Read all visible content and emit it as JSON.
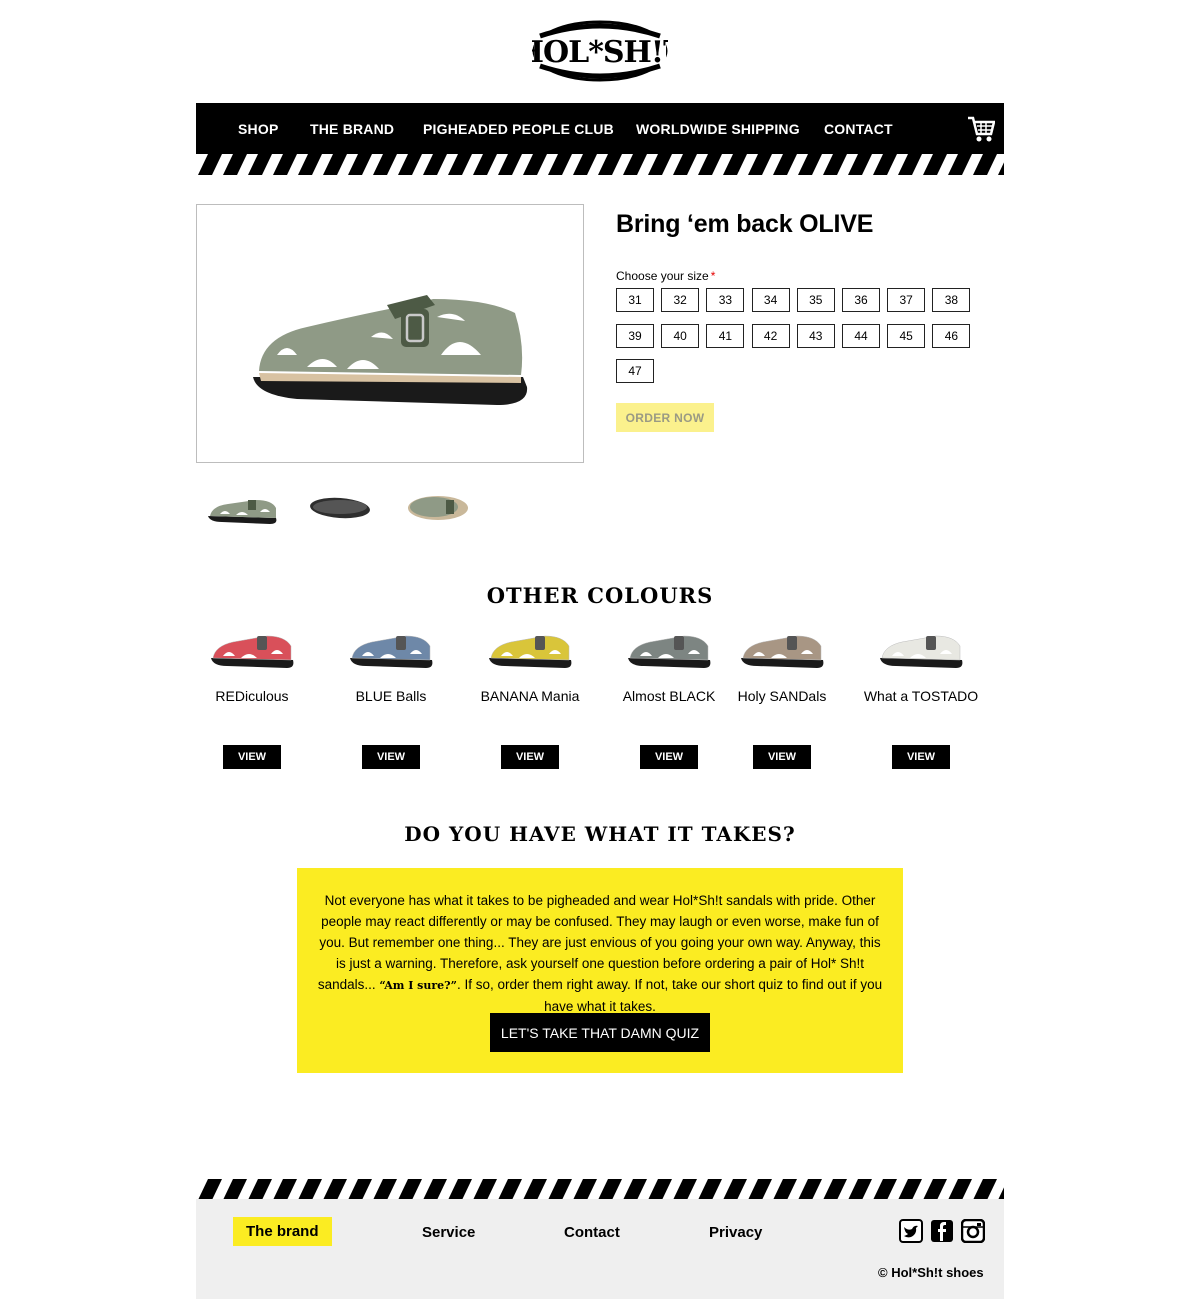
{
  "brand": {
    "logo_text": "HOL*SH!T"
  },
  "nav": {
    "items": [
      "SHOP",
      "THE BRAND",
      "PIGHEADED PEOPLE CLUB",
      "WORLDWIDE SHIPPING",
      "CONTACT"
    ],
    "cart_icon": "shopping-cart-icon"
  },
  "product": {
    "title": "Bring ‘em back OLIVE",
    "size_label": "Choose your size",
    "required_mark": "*",
    "sizes": [
      "31",
      "32",
      "33",
      "34",
      "35",
      "36",
      "37",
      "38",
      "39",
      "40",
      "41",
      "42",
      "43",
      "44",
      "45",
      "46",
      "47"
    ],
    "order_label": "ORDER NOW"
  },
  "other_colours": {
    "heading": "OTHER COLOURS",
    "items": [
      {
        "name": "REDiculous",
        "view": "VIEW",
        "color": "#d9505a"
      },
      {
        "name": "BLUE Balls",
        "view": "VIEW",
        "color": "#6e88a8"
      },
      {
        "name": "BANANA Mania",
        "view": "VIEW",
        "color": "#d9c53a"
      },
      {
        "name": "Almost BLACK",
        "view": "VIEW",
        "color": "#7d8582"
      },
      {
        "name": "Holy SANDals",
        "view": "VIEW",
        "color": "#a89684"
      },
      {
        "name": "What a TOSTADO",
        "view": "VIEW",
        "color": "#e8e8e2"
      }
    ]
  },
  "takes": {
    "heading": "DO YOU HAVE WHAT IT TAKES?",
    "text_before": "Not everyone has what it takes to be pigheaded and wear Hol*Sh!t sandals with pride. Other people may react differently or may be confused. They may laugh or even worse, make fun of you. But remember one thing... They are just envious of you going your own way. Anyway, this is just a warning. Therefore, ask yourself one question before ordering a pair of Hol* Sh!t sandals... ",
    "text_quote": "“Am I sure?”",
    "text_after": ". If so, order them right away. If not, take our short quiz to find out if you have what it takes.",
    "quiz_label": "LET'S TAKE THAT DAMN QUIZ"
  },
  "footer": {
    "links": [
      "The brand",
      "Service",
      "Contact",
      "Privacy"
    ],
    "social_icons": [
      "twitter-icon",
      "facebook-icon",
      "instagram-icon"
    ],
    "copyright": "© Hol*Sh!t shoes"
  },
  "colors": {
    "accent_yellow": "#fbec22",
    "order_yellow": "#fbf18d",
    "olive": "#8f9a86"
  }
}
